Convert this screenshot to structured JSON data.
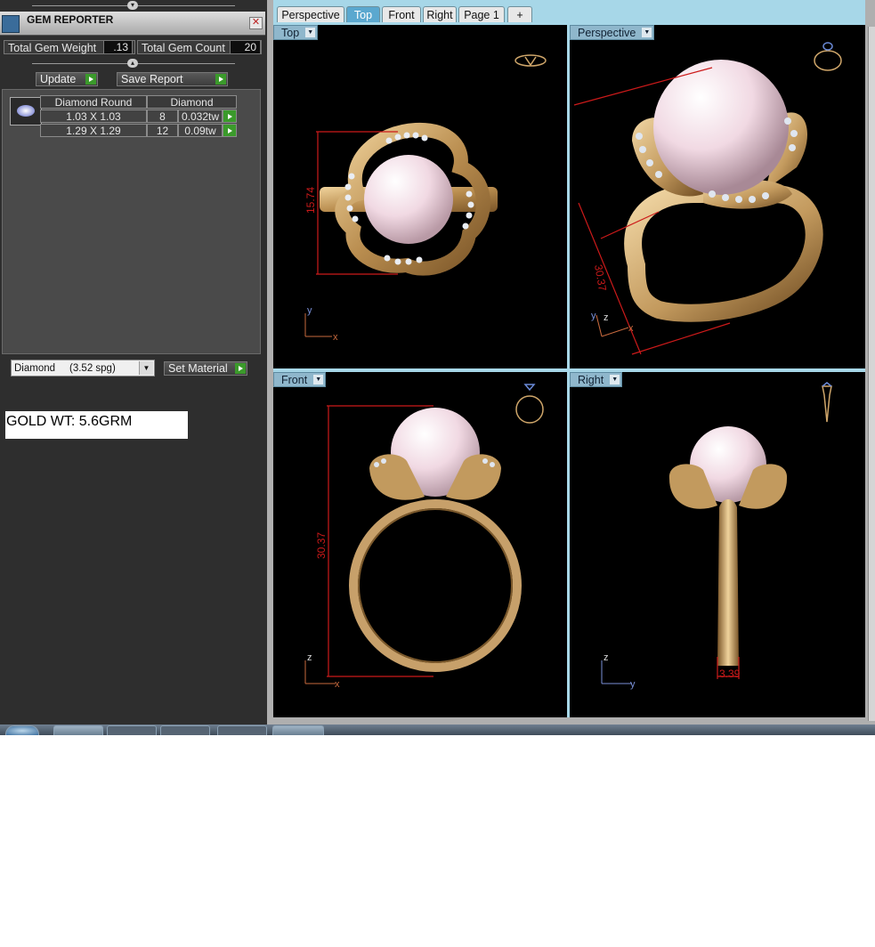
{
  "gem_reporter": {
    "title": "GEM REPORTER",
    "close_glyph": "✕",
    "total_weight_label": "Total Gem Weight",
    "total_weight_value": ".13",
    "total_count_label": "Total Gem Count",
    "total_count_value": "20",
    "update_label": "Update",
    "save_report_label": "Save Report",
    "columns": [
      "Diamond Round",
      "Diamond"
    ],
    "rows": [
      {
        "size": "1.03 X 1.03",
        "count": "8",
        "weight": "0.032tw"
      },
      {
        "size": "1.29 X 1.29",
        "count": "12",
        "weight": "0.09tw"
      }
    ],
    "material_value": "Diamond     (3.52 spg)",
    "set_material_label": "Set Material"
  },
  "note": "GOLD WT: 5.6GRM",
  "tabs": [
    {
      "label": "Perspective",
      "active": false
    },
    {
      "label": "Top",
      "active": true
    },
    {
      "label": "Front",
      "active": false
    },
    {
      "label": "Right",
      "active": false
    },
    {
      "label": "Page 1",
      "active": false
    },
    {
      "label": "+",
      "active": false
    }
  ],
  "viewports": {
    "top": {
      "label": "Top",
      "dimension": "15.74",
      "axis_x": "x",
      "axis_y": "y"
    },
    "perspective": {
      "label": "Perspective",
      "dimension": "30.37",
      "axis_x": "x",
      "axis_y": "y",
      "axis_z": "z"
    },
    "front": {
      "label": "Front",
      "dimension": "30.37",
      "axis_x": "x",
      "axis_z": "z"
    },
    "right": {
      "label": "Right",
      "dimension": "3.39",
      "axis_y": "y",
      "axis_z": "z"
    }
  },
  "colors": {
    "gold": "#d6b07a",
    "pearl": "#f3dfe8",
    "dimension": "#cc1a1a",
    "tab_active": "#5ba8cf"
  }
}
